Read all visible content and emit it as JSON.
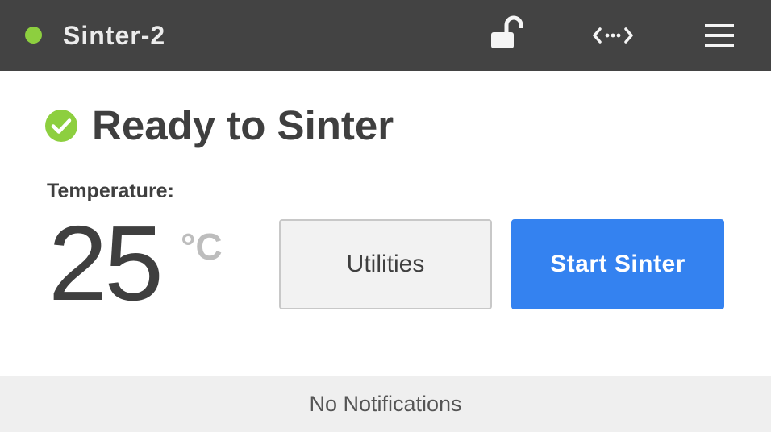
{
  "header": {
    "device_name": "Sinter-2",
    "online_indicator_color": "#8dcf3f",
    "icons": [
      "lock-open-icon",
      "connection-icon",
      "hamburger-menu-icon"
    ]
  },
  "status": {
    "icon": "check-circle-icon",
    "title": "Ready to Sinter",
    "color": "#8dcf3f"
  },
  "temperature": {
    "label": "Temperature:",
    "value": "25",
    "unit": "°C"
  },
  "actions": {
    "utilities_label": "Utilities",
    "start_label": "Start Sinter",
    "start_color": "#3482f0"
  },
  "notifications": {
    "text": "No Notifications"
  }
}
